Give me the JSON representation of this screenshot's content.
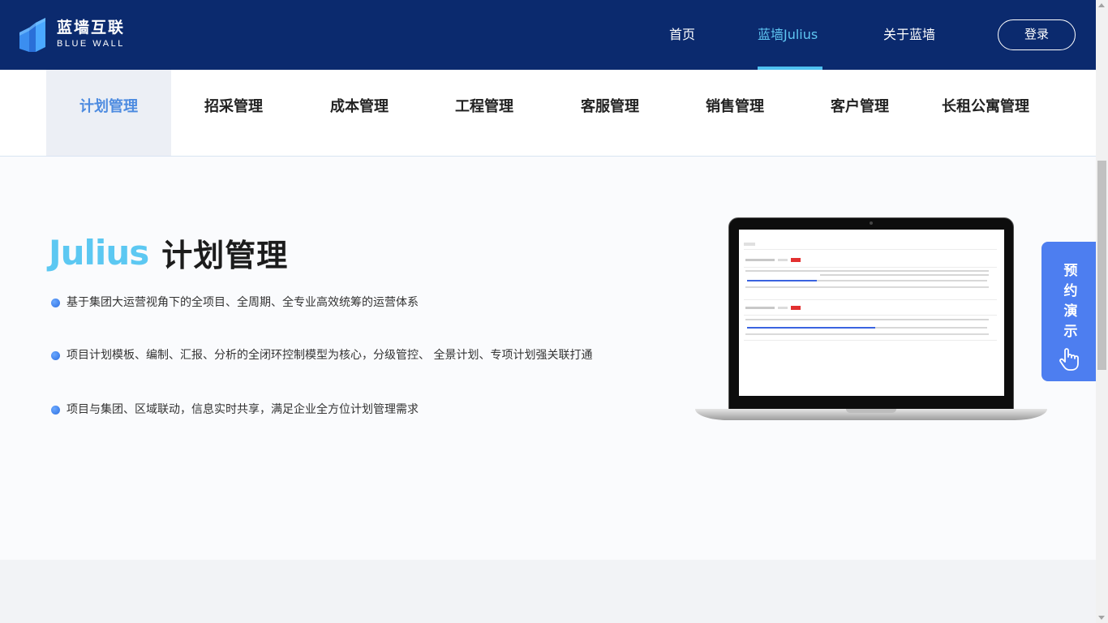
{
  "header": {
    "logo": {
      "name_cn": "蓝墙互联",
      "name_en": "BLUE WALL"
    },
    "nav": [
      {
        "label": "首页",
        "active": false
      },
      {
        "label": "蓝墙Julius",
        "active": true
      },
      {
        "label": "关于蓝墙",
        "active": false
      }
    ],
    "login_label": "登录"
  },
  "tabs": [
    {
      "label": "计划管理",
      "active": true
    },
    {
      "label": "招采管理",
      "active": false
    },
    {
      "label": "成本管理",
      "active": false
    },
    {
      "label": "工程管理",
      "active": false
    },
    {
      "label": "客服管理",
      "active": false
    },
    {
      "label": "销售管理",
      "active": false
    },
    {
      "label": "客户管理",
      "active": false
    },
    {
      "label": "长租公寓管理",
      "active": false
    }
  ],
  "main": {
    "brand_word": "Julius",
    "title": "计划管理",
    "bullets": [
      "基于集团大运营视角下的全项目、全周期、全专业高效统筹的运营体系",
      "项目计划模板、编制、汇报、分析的全闭环控制模型为核心，分级管控、 全景计划、专项计划强关联打通",
      "项目与集团、区域联动，信息实时共享，满足企业全方位计划管理需求"
    ]
  },
  "demo_button": {
    "label": "预约演示",
    "icon": "hand-pointer-icon"
  },
  "colors": {
    "header_bg": "#0b2a6e",
    "accent_cyan": "#5cc8f2",
    "tab_active_text": "#4d8be0",
    "demo_bg": "#4d7ef0"
  }
}
